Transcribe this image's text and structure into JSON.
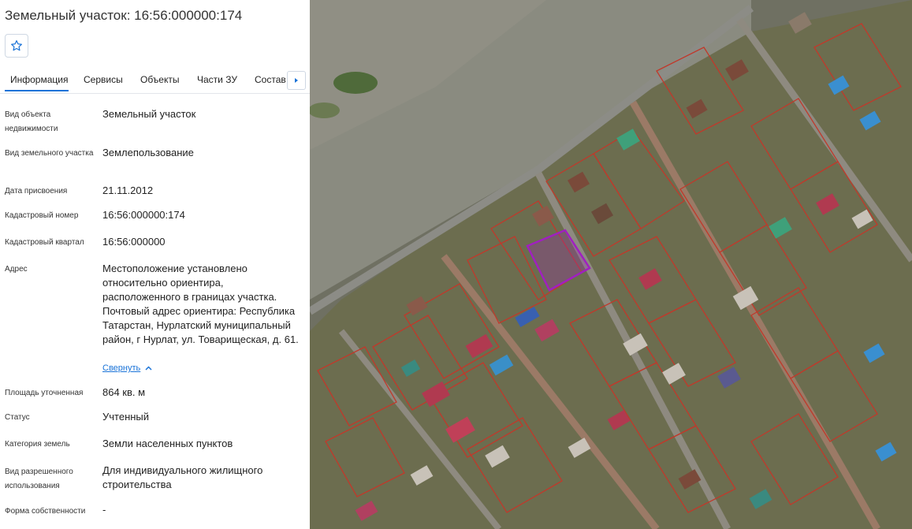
{
  "title": "Земельный участок: 16:56:000000:174",
  "tabs": [
    "Информация",
    "Сервисы",
    "Объекты",
    "Части ЗУ",
    "Состав"
  ],
  "collapse_label": "Свернуть",
  "rows": [
    {
      "label": "Вид объекта недвижимости",
      "value": "Земельный участок"
    },
    {
      "label": "Вид земельного участка",
      "value": "Землепользование"
    },
    {
      "label": "Дата присвоения",
      "value": "21.11.2012"
    },
    {
      "label": "Кадастровый номер",
      "value": "16:56:000000:174"
    },
    {
      "label": "Кадастровый квартал",
      "value": "16:56:000000"
    },
    {
      "label": "Адрес",
      "value": "Местоположение установлено относительно ориентира, расположенного в границах участка. Почтовый адрес ориентира: Республика Татарстан, Нурлатский муниципальный район, г Нурлат, ул. Товарищеская, д. 61."
    },
    {
      "label": "Площадь уточненная",
      "value": "864 кв. м"
    },
    {
      "label": "Статус",
      "value": "Учтенный"
    },
    {
      "label": "Категория земель",
      "value": "Земли населенных пунктов"
    },
    {
      "label": "Вид разрешенного использования",
      "value": "Для индивидуального жилищного строительства"
    },
    {
      "label": "Форма собственности",
      "value": "-"
    }
  ],
  "colors": {
    "accent": "#1a73d8",
    "parcel_border": "#c0392b",
    "selected_parcel": "#a020c0"
  }
}
